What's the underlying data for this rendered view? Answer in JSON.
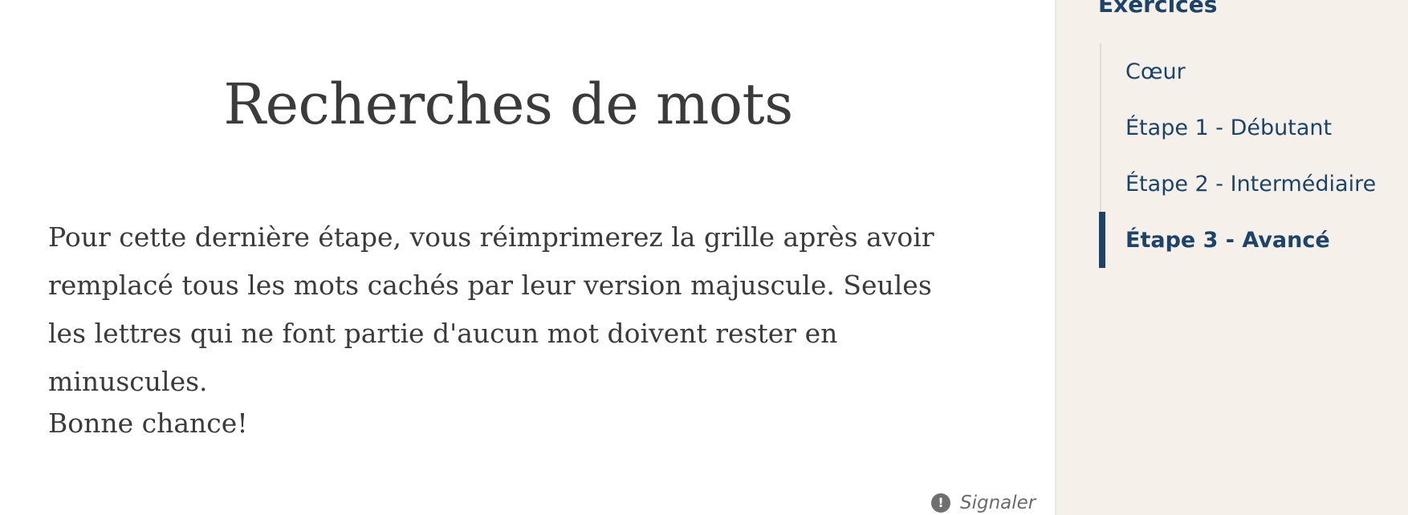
{
  "main": {
    "title": "Recherches de mots",
    "intro": "Pour cette dernière étape, vous réimprimerez la grille après avoir remplacé tous les mots cachés par leur version majuscule. Seules les lettres qui ne font partie d'aucun mot doivent rester en minuscules.",
    "closing": "Bonne chance!",
    "report": {
      "icon": "exclamation-circle-icon",
      "label": "Signaler"
    }
  },
  "sidebar": {
    "heading": "Exercices",
    "items": [
      {
        "label": "Cœur",
        "active": false
      },
      {
        "label": "Étape 1 - Débutant",
        "active": false
      },
      {
        "label": "Étape 2 - Intermédiaire",
        "active": false
      },
      {
        "label": "Étape 3 - Avancé",
        "active": true
      }
    ]
  },
  "colors": {
    "accent": "#1d4468",
    "text": "#3b3b3b",
    "sidebar_bg": "#f5f1ea",
    "card_bg": "#ffffff"
  }
}
